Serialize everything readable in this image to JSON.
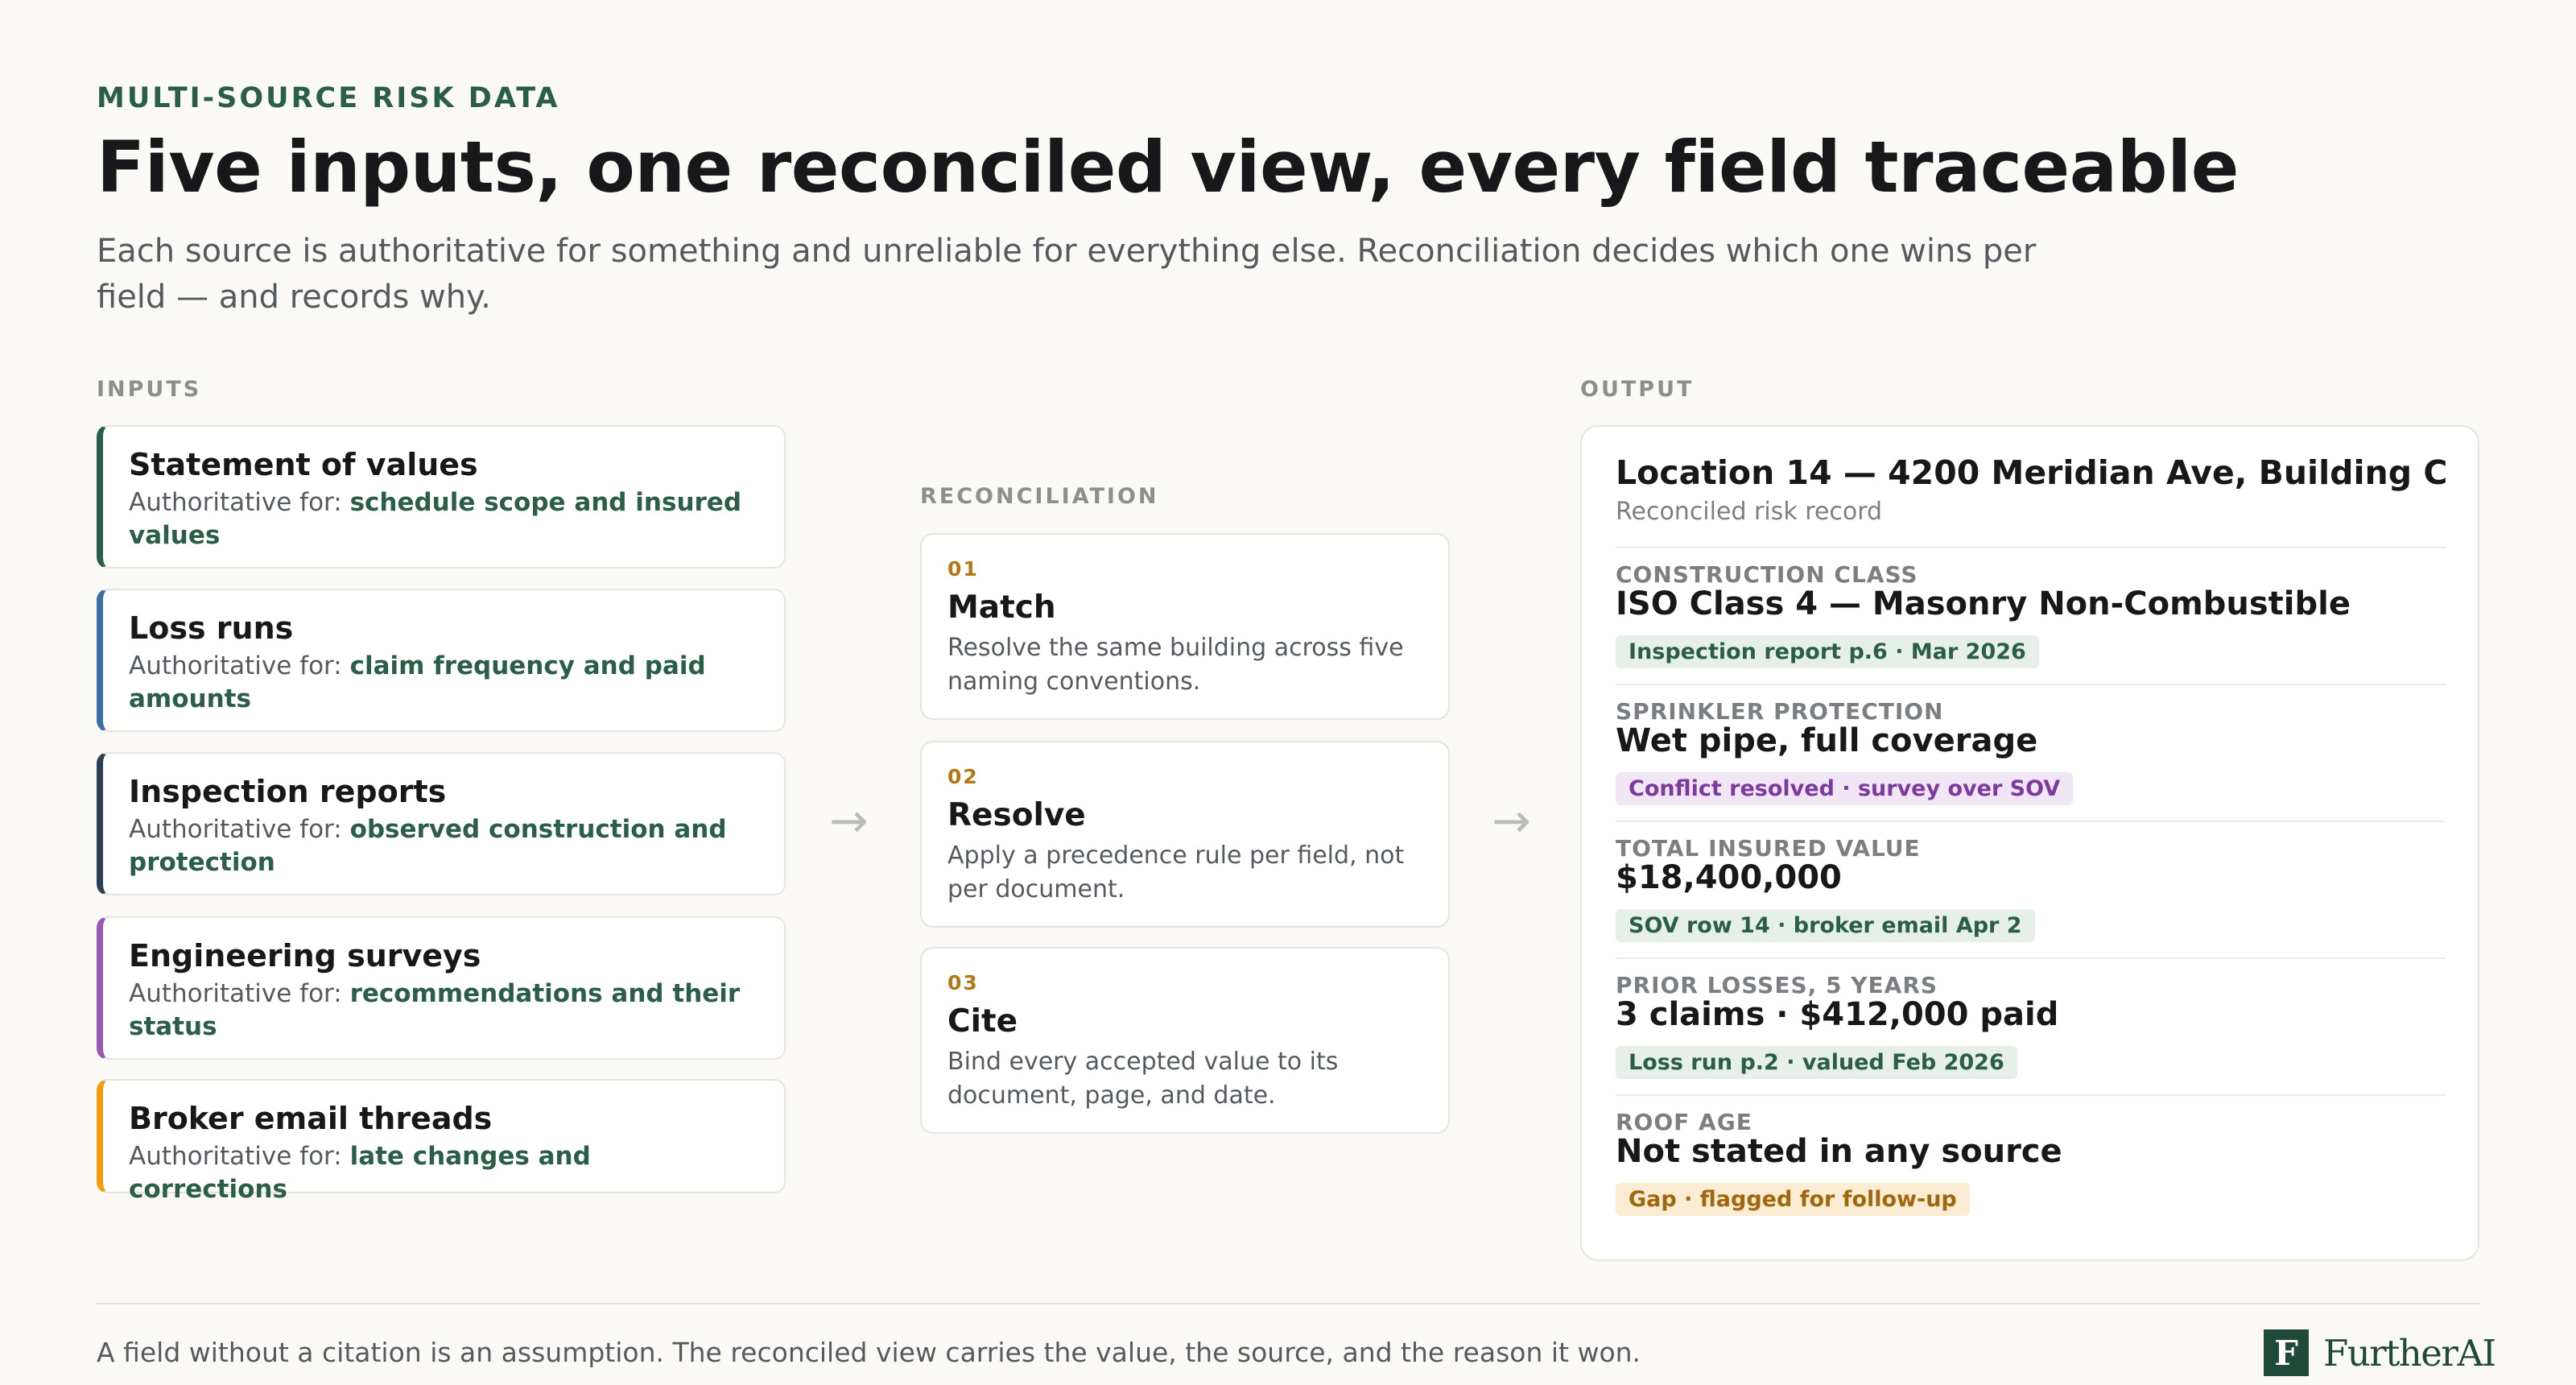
{
  "header": {
    "eyebrow": "MULTI-SOURCE RISK DATA",
    "title": "Five inputs, one reconciled view, every field traceable",
    "subtitle": "Each source is authoritative for something and unreliable for everything else. Reconciliation decides which one wins per field — and records why."
  },
  "inputs": {
    "label": "INPUTS",
    "prefix": "Authoritative for: ",
    "items": [
      {
        "title": "Statement of values",
        "authority": "schedule scope and insured values",
        "color": "#2a5e48"
      },
      {
        "title": "Loss runs",
        "authority": "claim frequency and paid amounts",
        "color": "#3a6ea5"
      },
      {
        "title": "Inspection reports",
        "authority": "observed construction and protection",
        "color": "#2c3e50"
      },
      {
        "title": "Engineering surveys",
        "authority": "recommendations and their status",
        "color": "#9b59b6"
      },
      {
        "title": "Broker email threads",
        "authority": "late changes and corrections",
        "color": "#f39c12"
      }
    ]
  },
  "reconciliation": {
    "label": "RECONCILIATION",
    "steps": [
      {
        "num": "01",
        "title": "Match",
        "desc": "Resolve the same building across five naming conventions."
      },
      {
        "num": "02",
        "title": "Resolve",
        "desc": "Apply a precedence rule per field, not per document."
      },
      {
        "num": "03",
        "title": "Cite",
        "desc": "Bind every accepted value to its document, page, and date."
      }
    ]
  },
  "arrows": {
    "glyph": "→"
  },
  "output": {
    "label": "OUTPUT",
    "title": "Location 14 — 4200 Meridian Ave, Building C",
    "subtitle": "Reconciled risk record",
    "fields": [
      {
        "label": "CONSTRUCTION CLASS",
        "value": "ISO Class 4 — Masonry Non-Combustible",
        "chip": "Inspection report p.6 · Mar 2026",
        "chip_style": "green"
      },
      {
        "label": "SPRINKLER PROTECTION",
        "value": "Wet pipe, full coverage",
        "chip": "Conflict resolved · survey over SOV",
        "chip_style": "purple"
      },
      {
        "label": "TOTAL INSURED VALUE",
        "value": "$18,400,000",
        "chip": "SOV row 14 · broker email Apr 2",
        "chip_style": "green"
      },
      {
        "label": "PRIOR LOSSES, 5 YEARS",
        "value": "3 claims · $412,000 paid",
        "chip": "Loss run p.2 · valued Feb 2026",
        "chip_style": "green"
      },
      {
        "label": "ROOF AGE",
        "value": "Not stated in any source",
        "chip": "Gap · flagged for follow-up",
        "chip_style": "amber"
      }
    ]
  },
  "footer": {
    "text": "A field without a citation is an assumption. The reconciled view carries the value, the source, and the reason it won.",
    "logo_mark": "F",
    "logo_word": "FurtherAI"
  }
}
